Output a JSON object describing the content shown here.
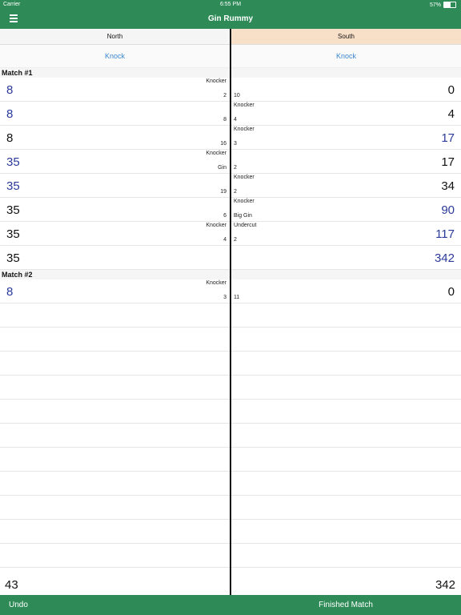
{
  "status": {
    "carrier": "Carrier",
    "time": "6:55 PM",
    "battery": "57%",
    "battery_level": 0.57
  },
  "app": {
    "title": "Gin Rummy"
  },
  "players": {
    "north": "North",
    "south": "South"
  },
  "knock": {
    "north": "Knock",
    "south": "Knock"
  },
  "matches": [
    {
      "label": "Match #1",
      "rows": [
        {
          "n_score": "8",
          "n_blue": true,
          "n_top": "Knocker",
          "n_bottom": "2",
          "s_top": "",
          "s_bottom": "10",
          "s_score": "0",
          "s_blue": false
        },
        {
          "n_score": "8",
          "n_blue": true,
          "n_top": "",
          "n_bottom": "8",
          "s_top": "Knocker",
          "s_bottom": "4",
          "s_score": "4",
          "s_blue": false
        },
        {
          "n_score": "8",
          "n_blue": false,
          "n_top": "",
          "n_bottom": "16",
          "s_top": "Knocker",
          "s_bottom": "3",
          "s_score": "17",
          "s_blue": true
        },
        {
          "n_score": "35",
          "n_blue": true,
          "n_top": "Knocker",
          "n_bottom": "Gin",
          "s_top": "",
          "s_bottom": "2",
          "s_score": "17",
          "s_blue": false
        },
        {
          "n_score": "35",
          "n_blue": true,
          "n_top": "",
          "n_bottom": "19",
          "s_top": "Knocker",
          "s_bottom": "2",
          "s_score": "34",
          "s_blue": false
        },
        {
          "n_score": "35",
          "n_blue": false,
          "n_top": "",
          "n_bottom": "6",
          "s_top": "Knocker",
          "s_bottom": "Big Gin",
          "s_score": "90",
          "s_blue": true
        },
        {
          "n_score": "35",
          "n_blue": false,
          "n_top": "Knocker",
          "n_bottom": "4",
          "s_top": "Undercut",
          "s_bottom": "2",
          "s_score": "117",
          "s_blue": true
        },
        {
          "n_score": "35",
          "n_blue": false,
          "n_top": "",
          "n_bottom": "",
          "s_top": "",
          "s_bottom": "",
          "s_score": "342",
          "s_blue": true
        }
      ]
    },
    {
      "label": "Match #2",
      "rows": [
        {
          "n_score": "8",
          "n_blue": true,
          "n_top": "Knocker",
          "n_bottom": "3",
          "s_top": "",
          "s_bottom": "11",
          "s_score": "0",
          "s_blue": false
        }
      ]
    }
  ],
  "totals": {
    "north": "43",
    "south": "342"
  },
  "bottom": {
    "undo": "Undo",
    "finished": "Finished Match"
  },
  "colors": {
    "green": "#2e8b57",
    "blue_score": "#2a3a9a",
    "link_blue": "#3a86d0",
    "south_highlight": "#f8dfc8"
  }
}
